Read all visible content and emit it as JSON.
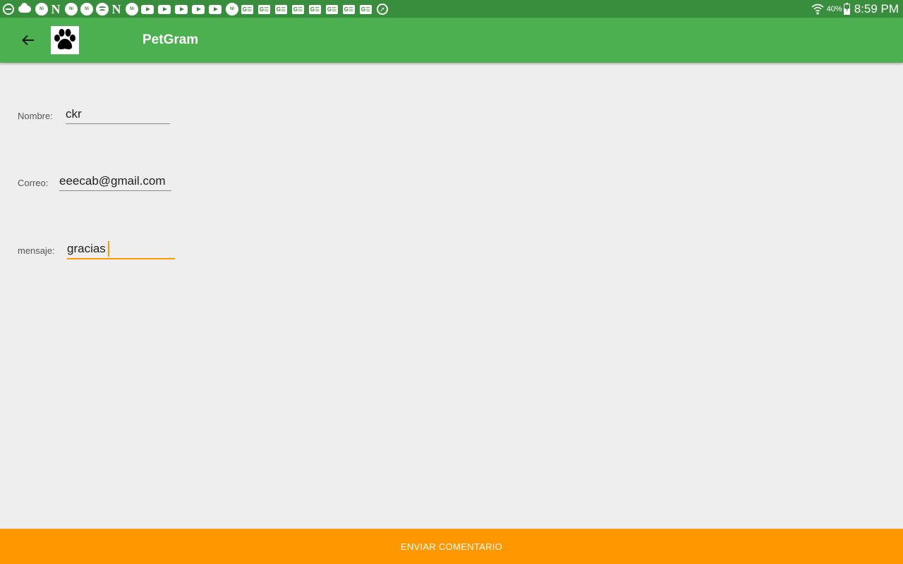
{
  "status_bar": {
    "notification_icons": [
      "dnd-icon",
      "cloud-icon",
      "ni-icon",
      "netflix-icon",
      "ni-icon",
      "ni-icon",
      "spotify-icon",
      "netflix-icon",
      "ni-icon",
      "youtube-icon",
      "youtube-icon",
      "youtube-icon",
      "youtube-icon",
      "youtube-icon",
      "ni-icon",
      "g-icon",
      "g-icon",
      "g-icon",
      "g-icon",
      "g-icon",
      "g-icon",
      "g-icon",
      "g-icon",
      "compass-icon"
    ],
    "battery_percent": "40%",
    "time": "8:59 PM"
  },
  "app_bar": {
    "title": "PetGram",
    "color": "#4caf50",
    "status_color": "#388e3c"
  },
  "form": {
    "name": {
      "label": "Nombre:",
      "value": "ckr"
    },
    "email": {
      "label": "Correo:",
      "value": "eeecab@gmail.com"
    },
    "message": {
      "label": "mensaje:",
      "value": "gracias"
    }
  },
  "send_button": {
    "label": "ENVIAR COMENTARIO",
    "color": "#ff9800"
  }
}
